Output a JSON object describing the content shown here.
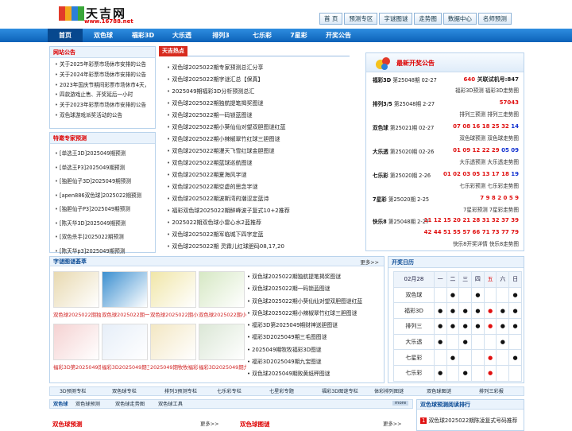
{
  "brand": {
    "name": "天吉网",
    "url": "www.16788.net"
  },
  "toplinks": [
    "首 页",
    "预测专区",
    "字谜图谜",
    "走势图",
    "数据中心",
    "名师预测"
  ],
  "nav": [
    "首页",
    "双色球",
    "福彩3D",
    "大乐透",
    "排列3",
    "七乐彩",
    "7星彩",
    "开奖公告"
  ],
  "notice": {
    "title": "网站公告",
    "items": [
      "关于2025年彩票市场休市安排的公告",
      "关于2024年彩票市场休市安排的公告",
      "2023年国庆节期间彩票市场休市4天，10...",
      "四款游戏止售、开奖延后一小时",
      "关于2023年彩票市场休市安排的公告",
      "双色球游戏派奖活动的公告"
    ]
  },
  "experts": {
    "title": "特邀专家预测",
    "items": [
      "[单选王3D]2025049期预测",
      "[单选王P3]2025049期预测",
      "[独胆仙子3D]2025049期预测",
      "[apen886双色球]2025022期预测",
      "[独胆仙子P3]2025049期预测",
      "[陈天华3D]2025049期预测",
      "[双色杀手]2025022期预测",
      "[陈天华p3]2025049期预测"
    ]
  },
  "hot": {
    "tag": "天吉热点",
    "items": [
      "双色球2025022期专家预测总汇分享",
      "双色球2025022期字谜汇总【保真】",
      "2025049期福彩3D分析预测总汇",
      "双色球2025022期独航提笔揭奖图谜",
      "双色球2025022期一码锁蓝图谜",
      "双色球2025022期小葵仙仙对望双胆图谜红蓝",
      "双色球2025022期小辣椒翠竹红球三胆图谜",
      "双色球2025022期漫天飞雪红球金胆图谜",
      "双色球2025022期蓝球巡航图谜",
      "双色球2025022期夏海风字谜",
      "双色球2025022期空虚的思念字谜",
      "双色球2025022期波斯湾的潮涩定蓝诗",
      "福彩双色球2025022期醉峰波子复式10+2推荐",
      "2025022期双色球小雷心水2蓝推荐",
      "双色球2025022期军临城下四字定蓝",
      "双色球2025022期 灵霖儿红球胆码08,17,20"
    ]
  },
  "draws": {
    "title": "最新开奖公告",
    "rows": [
      {
        "name": "福彩3D",
        "issue": "第25048期 02-27",
        "red": "640",
        "extra": "关联试机号:847",
        "links": "福彩3D预测 福彩3D走势图"
      },
      {
        "name": "排列3/5",
        "issue": "第25048期 2-27",
        "red": "57043",
        "links": "排列三预测 排列三走势图"
      },
      {
        "name": "双色球",
        "issue": "第25021期 02-27",
        "red": "07 08 16 18 25 32",
        "blue": "14",
        "links": "双色球预测 双色球走势图"
      },
      {
        "name": "大乐透",
        "issue": "第25020期 02-26",
        "red": "01 09 12 22 29",
        "blue": "05 09",
        "links": "大乐透预测 大乐透走势图"
      },
      {
        "name": "七乐彩",
        "issue": "第25020期 2-26",
        "red": "01 02 03 05 13 17 18",
        "blue": "19",
        "links": "七乐彩预测 七乐彩走势图"
      },
      {
        "name": "7星彩",
        "issue": "第25020期 2-25",
        "red": "7 9 8 2 0 5 9",
        "links": "7星彩预测 7星彩走势图"
      },
      {
        "name": "快乐8",
        "issue": "第25048期 2-27",
        "red": "11 12 15 20 21 28 31 32 37 39",
        "red2": "42 44 51 55 57 66 71 73 77 79",
        "links": "快乐8开奖详情 快乐8走势图"
      }
    ]
  },
  "pics": {
    "title": "字谜图谜荟萃",
    "more": "更多>>",
    "captions": [
      "双色球2025022期独",
      "双色球2025022期一",
      "双色球2025022期小",
      "双色球2025022期小",
      "福彩3D第2025049期",
      "福彩3D2025049期三",
      "2025049期牧牧福彩",
      "福彩3D2025049期九"
    ],
    "list": [
      "双色球2025022期独航提笔揭奖图谜",
      "双色球2025022期一码锁蓝图谜",
      "双色球2025022期小葵仙仙对望双胆图谜红蓝",
      "双色球2025022期小辣椒翠竹红球三胆图谜",
      "福彩3D第2025049期财神送胆图谜",
      "福彩3D2025049期三毛图图谜",
      "2025049期牧牧福彩3D图谜",
      "福彩3D2025049期九宝图谜",
      "双色球2025049期败黄纸秤图谜"
    ]
  },
  "calendar": {
    "title": "开奖日历",
    "date": "02月28",
    "days": [
      "一",
      "二",
      "三",
      "四",
      "五",
      "六",
      "日"
    ],
    "rows": [
      {
        "name": "双色球",
        "cells": [
          "",
          "●",
          "",
          "●",
          "",
          "",
          "●"
        ]
      },
      {
        "name": "福彩3D",
        "cells": [
          "●",
          "●",
          "●",
          "●",
          "●",
          "●",
          "●"
        ]
      },
      {
        "name": "排列三",
        "cells": [
          "●",
          "●",
          "●",
          "●",
          "●",
          "●",
          "●"
        ]
      },
      {
        "name": "大乐透",
        "cells": [
          "●",
          "",
          "●",
          "",
          "",
          "●",
          ""
        ]
      },
      {
        "name": "七星彩",
        "cells": [
          "",
          "●",
          "",
          "",
          "●",
          "",
          "●"
        ]
      },
      {
        "name": "七乐彩",
        "cells": [
          "●",
          "",
          "●",
          "",
          "●",
          "",
          ""
        ]
      }
    ],
    "today_col": 4
  },
  "subnav": [
    "3D预测专栏",
    "双色球专栏",
    "排列3预测专栏",
    "七乐彩专栏",
    "七星彩专题",
    "福彩3D图谜专栏",
    "体彩排列图谜",
    "双色球图谜",
    "排列三彩报"
  ],
  "row2": {
    "links": [
      "双色球",
      "双色球预测",
      "双色球走势图",
      "双色球工具"
    ],
    "left_title": "双色球预测",
    "mid_title": "双色球图谜",
    "more": "更多>>",
    "rank_title": "双色球预测阅读排行",
    "rank_first": "双色球2025022期陈凌复式号码推荐",
    "more_label": "more"
  }
}
